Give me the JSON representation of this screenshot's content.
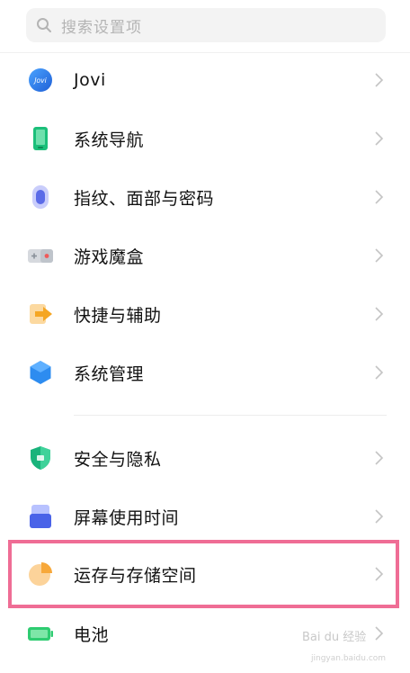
{
  "search": {
    "placeholder": "搜索设置项"
  },
  "items": [
    {
      "label": "Jovi",
      "icon": "jovi-icon",
      "icon_text": "Jovi"
    },
    {
      "label": "系统导航",
      "icon": "phone-navigation-icon"
    },
    {
      "label": "指纹、面部与密码",
      "icon": "fingerprint-icon"
    },
    {
      "label": "游戏魔盒",
      "icon": "gamepad-icon"
    },
    {
      "label": "快捷与辅助",
      "icon": "shortcut-arrow-icon"
    },
    {
      "label": "系统管理",
      "icon": "hexagon-icon"
    },
    {
      "label": "安全与隐私",
      "icon": "shield-icon"
    },
    {
      "label": "屏幕使用时间",
      "icon": "screen-time-icon"
    },
    {
      "label": "运存与存储空间",
      "icon": "pie-chart-icon"
    },
    {
      "label": "电池",
      "icon": "battery-icon"
    }
  ],
  "watermark": {
    "text": "Bai du 经验",
    "url": "jingyan.baidu.com"
  },
  "colors": {
    "highlight": "#ef6d95",
    "jovi": "#2a7be4",
    "nav": "#1bbf7a",
    "fingerprint": "#5b6be8",
    "shortcut": "#f5a623",
    "system": "#2d8cf0",
    "security": "#19b37b",
    "storage": "#f7a83a",
    "battery": "#2ecc71"
  }
}
